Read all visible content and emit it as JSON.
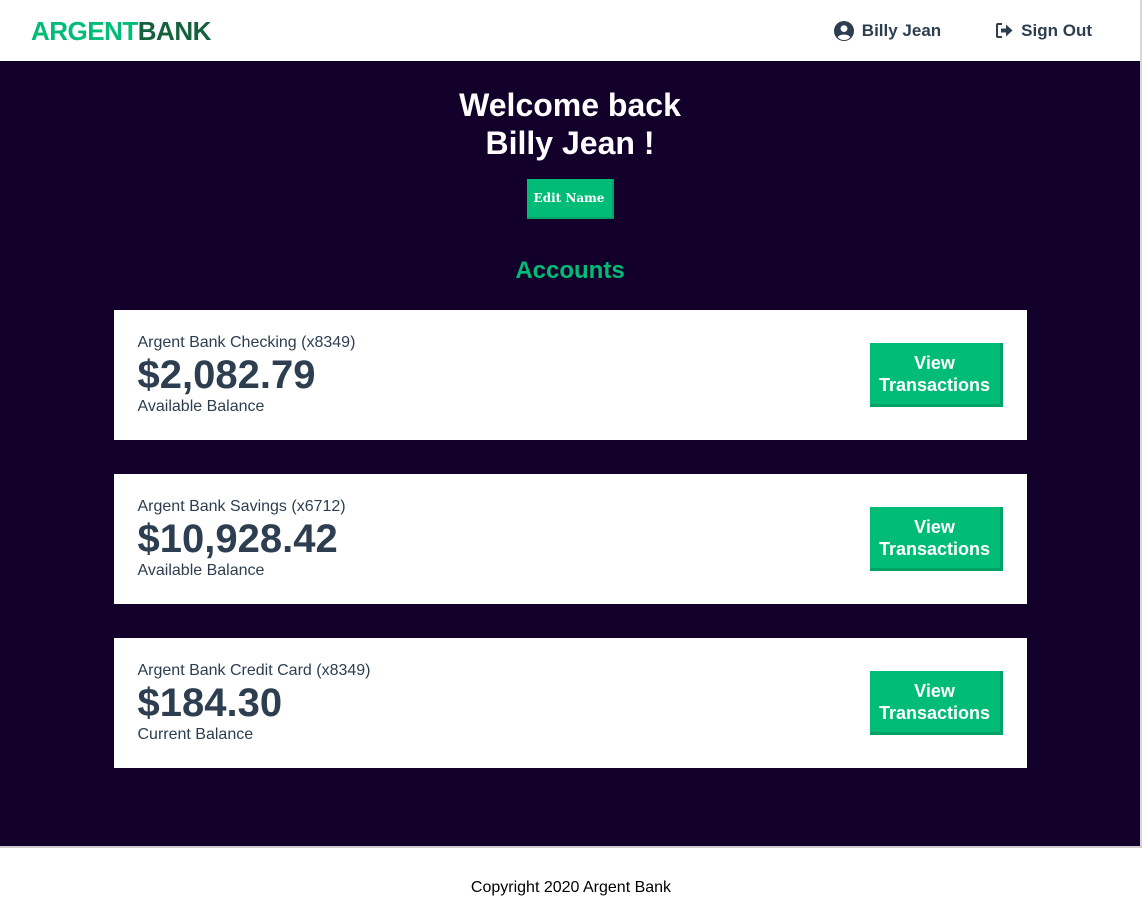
{
  "nav": {
    "logo_part1": "ARGENT",
    "logo_part2": "BANK",
    "user_name": "Billy Jean",
    "user_icon": "user-circle-icon",
    "sign_out_label": "Sign Out",
    "sign_out_icon": "sign-out-icon"
  },
  "header": {
    "welcome_line1": "Welcome back",
    "welcome_line2": "Billy Jean !",
    "edit_button": "Edit Name"
  },
  "accounts": {
    "title": "Accounts",
    "items": [
      {
        "name": "Argent Bank Checking (x8349)",
        "amount": "$2,082.79",
        "description": "Available Balance",
        "button_line1": "View",
        "button_line2": "Transactions"
      },
      {
        "name": "Argent Bank Savings (x6712)",
        "amount": "$10,928.42",
        "description": "Available Balance",
        "button_line1": "View",
        "button_line2": "Transactions"
      },
      {
        "name": "Argent Bank Credit Card (x8349)",
        "amount": "$184.30",
        "description": "Current Balance",
        "button_line1": "View",
        "button_line2": "Transactions"
      }
    ]
  },
  "footer": {
    "copyright": "Copyright 2020 Argent Bank"
  },
  "colors": {
    "brand_green": "#00bc77",
    "brand_dark_green": "#14613c",
    "main_background": "#12002b",
    "text_dark": "#2c3e50"
  }
}
